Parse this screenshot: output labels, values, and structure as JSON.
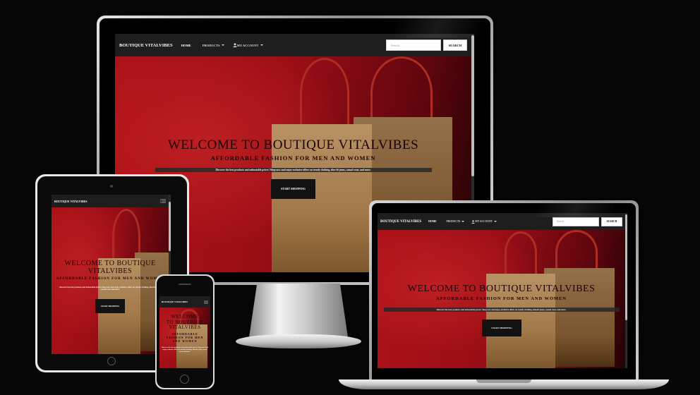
{
  "site": {
    "brand": "BOUTIQUE VITALVIBES",
    "nav": {
      "home": "HOME",
      "products": "PRODUCTS",
      "account": "MY ACCOUNT",
      "search_placeholder": "Search",
      "search_button": "SEARCH"
    },
    "hero": {
      "title": "WELCOME TO BOUTIQUE VITALVIBES",
      "title_line1": "WELCOME TO BOUTIQUE",
      "title_line2": "VITALVIBES",
      "phone_title_line1": "WELCOME",
      "phone_title_line2": "TO BOUTIQUE",
      "phone_title_line3": "VITALVIBES",
      "subtitle": "AFFORDABLE FASHION FOR MEN AND WOMEN",
      "phone_subtitle_line1": "AFFORDABLE",
      "phone_subtitle_line2": "FASHION FOR MEN",
      "phone_subtitle_line3": "AND WOMEN",
      "description": "Discover the best products and unbeatable prices! Shop now and enjoy exclusive offers on trendy clothing, slim-fit jeans, casual wear, and more.",
      "cta": "START SHOPPING"
    }
  },
  "icons": {
    "account": "user-icon",
    "dropdown": "caret-down-icon",
    "menu": "hamburger-icon"
  },
  "colors": {
    "hero_red": "#c4151b",
    "navbar": "#1e1e1e",
    "button": "#121212",
    "kraft_bag": "#c99d68"
  }
}
